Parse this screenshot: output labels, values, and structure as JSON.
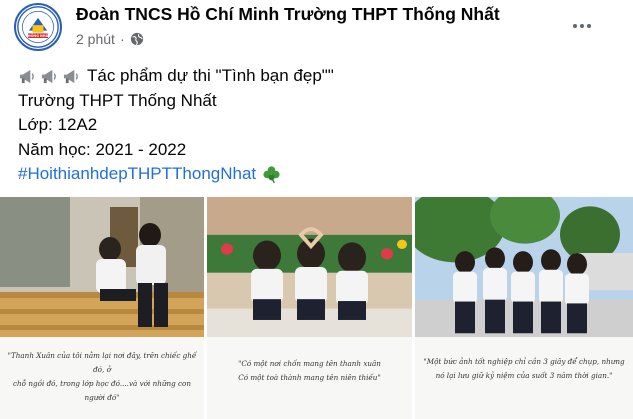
{
  "post": {
    "page_name": "Đoàn TNCS Hồ Chí Minh Trường THPT Thống Nhất",
    "timestamp": "2 phút",
    "separator": "·",
    "avatar_text": "THỐNG NHẤT",
    "lines": {
      "title": "Tác phẩm dự thi \"Tình bạn đẹp\"\"",
      "school": "Trường THPT Thống Nhất",
      "class": "Lớp: 12A2",
      "year": "Năm học: 2021 - 2022",
      "hashtag": "#HoithianhdepTHPTThongNhat"
    },
    "icons": [
      "globe-icon",
      "more-options-icon",
      "megaphone-icon",
      "clover-icon"
    ]
  },
  "photos": [
    {
      "caption_1": "\"Thanh Xuân của tôi nằm lại nơi đây, trên chiếc ghế đó, ở",
      "caption_2": "chỗ ngồi đó, trong lớp học đó....và với những con người đó\""
    },
    {
      "caption_1": "\"Có một nơi chốn mang tên thanh xuân",
      "caption_2": "Có một toà thành mang tên niên thiếu\""
    },
    {
      "caption_1": "\"Một bức ảnh tốt nghiệp chỉ cần 3 giây để chụp, nhưng",
      "caption_2": "nó lại lưu giữ kỷ niệm của suốt 3 năm thời gian.\""
    }
  ],
  "colors": {
    "link": "#216fdb",
    "muted": "#65676b",
    "text": "#050505",
    "avatar_border": "#2b5fb5"
  }
}
